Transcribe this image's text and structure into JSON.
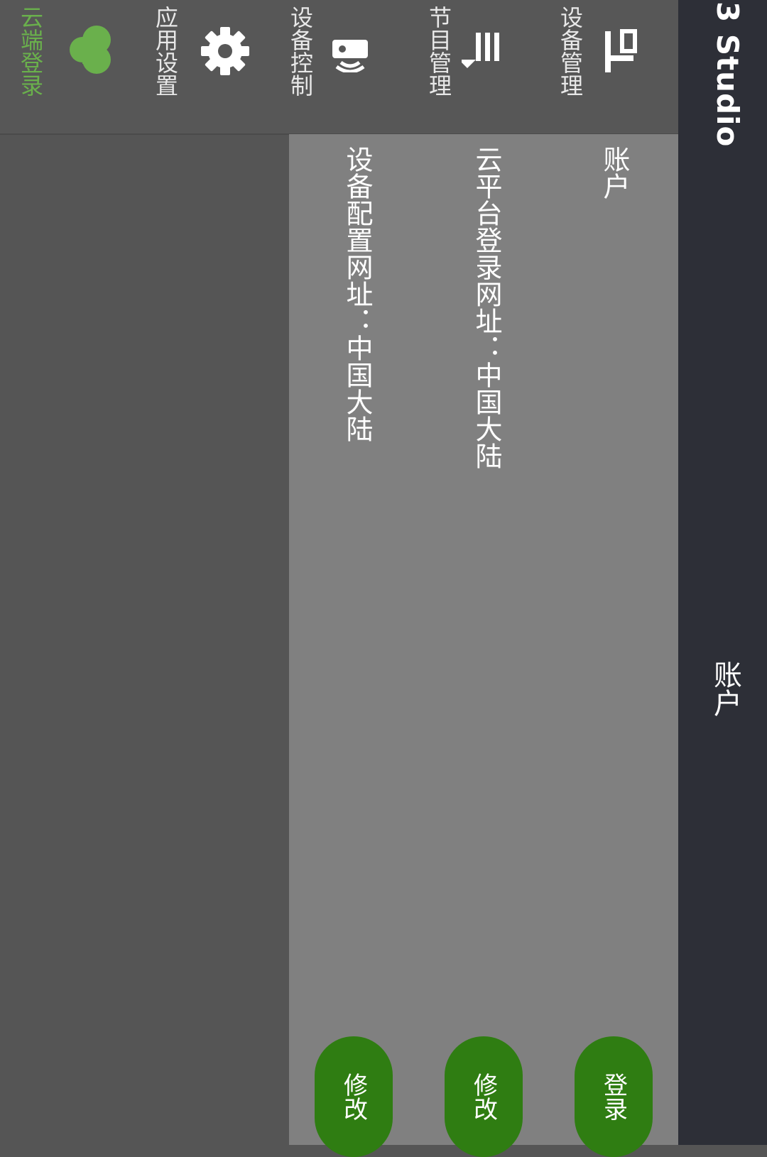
{
  "app": {
    "title": "3 Studio"
  },
  "header": {
    "title": "账户"
  },
  "nav": {
    "items": [
      {
        "label": "设备管理",
        "icon": "device-manage-icon"
      },
      {
        "label": "节目管理",
        "icon": "program-list-icon"
      },
      {
        "label": "设备控制",
        "icon": "remote-control-icon"
      },
      {
        "label": "应用设置",
        "icon": "gear-icon"
      },
      {
        "label": "云端登录",
        "icon": "cloud-icon",
        "active": true
      }
    ]
  },
  "account": {
    "section_label": "账户",
    "login_button": "登录",
    "platform_url_label": "云平台登录网址：中国大陆",
    "platform_edit_button": "修改",
    "device_url_label": "设备配置网址：中国大陆",
    "device_edit_button": "修改"
  },
  "colors": {
    "accent": "#2f7d12",
    "active_nav": "#6ab04c",
    "appbar": "#2d2f37",
    "panel": "#808080",
    "background": "#555555"
  }
}
